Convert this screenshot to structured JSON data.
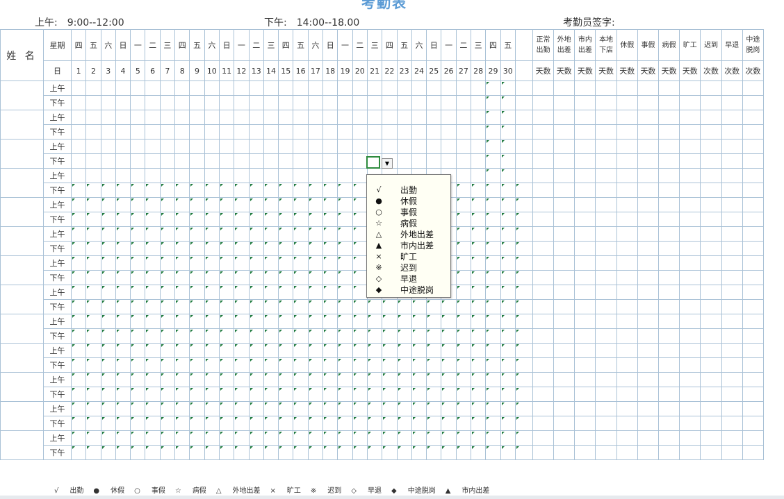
{
  "title": "考勤表",
  "header": {
    "am_label": "上午:",
    "am_value": "9:00--12:00",
    "pm_label": "下午:",
    "pm_value": "14:00--18.00",
    "signer_label": "考勤员签字:"
  },
  "table": {
    "name_header": "姓 名",
    "weekday_label": "星期",
    "day_label": "日",
    "weekdays": [
      "四",
      "五",
      "六",
      "日",
      "一",
      "二",
      "三",
      "四",
      "五",
      "六",
      "日",
      "一",
      "二",
      "三",
      "四",
      "五",
      "六",
      "日",
      "一",
      "二",
      "三",
      "四",
      "五",
      "六",
      "日",
      "一",
      "二",
      "三",
      "四",
      "五"
    ],
    "days": [
      "1",
      "2",
      "3",
      "4",
      "5",
      "6",
      "7",
      "8",
      "9",
      "10",
      "11",
      "12",
      "13",
      "14",
      "15",
      "16",
      "17",
      "18",
      "19",
      "20",
      "21",
      "22",
      "23",
      "24",
      "25",
      "26",
      "27",
      "28",
      "29",
      "30"
    ],
    "stats": [
      "正常出勤",
      "外地出差",
      "市内出差",
      "本地下店",
      "休假",
      "事假",
      "病假",
      "旷工",
      "迟到",
      "早退",
      "中途脱岗"
    ],
    "stat_units": [
      "天数",
      "天数",
      "天数",
      "天数",
      "天数",
      "天数",
      "天数",
      "天数",
      "次数",
      "次数",
      "次数"
    ],
    "period_am": "上午",
    "period_pm": "下午",
    "employee_rows": 13
  },
  "dropdown": {
    "arrow": "▼",
    "options": [
      {
        "symbol": "√",
        "label": "出勤"
      },
      {
        "symbol": "●",
        "label": "休假"
      },
      {
        "symbol": "○",
        "label": "事假"
      },
      {
        "symbol": "☆",
        "label": "病假"
      },
      {
        "symbol": "△",
        "label": "外地出差"
      },
      {
        "symbol": "▲",
        "label": "市内出差"
      },
      {
        "symbol": "×",
        "label": "旷工"
      },
      {
        "symbol": "※",
        "label": "迟到"
      },
      {
        "symbol": "◇",
        "label": "早退"
      },
      {
        "symbol": "◆",
        "label": "中途脱岗"
      }
    ]
  },
  "legend": [
    {
      "symbol": "√",
      "label": "出勤"
    },
    {
      "symbol": "●",
      "label": "休假"
    },
    {
      "symbol": "○",
      "label": "事假"
    },
    {
      "symbol": "☆",
      "label": "病假"
    },
    {
      "symbol": "△",
      "label": "外地出差"
    },
    {
      "symbol": "×",
      "label": "旷工"
    },
    {
      "symbol": "※",
      "label": "迟到"
    },
    {
      "symbol": "◇",
      "label": "早退"
    },
    {
      "symbol": "◆",
      "label": "中途脱岗"
    },
    {
      "symbol": "▲",
      "label": "市内出差"
    }
  ]
}
